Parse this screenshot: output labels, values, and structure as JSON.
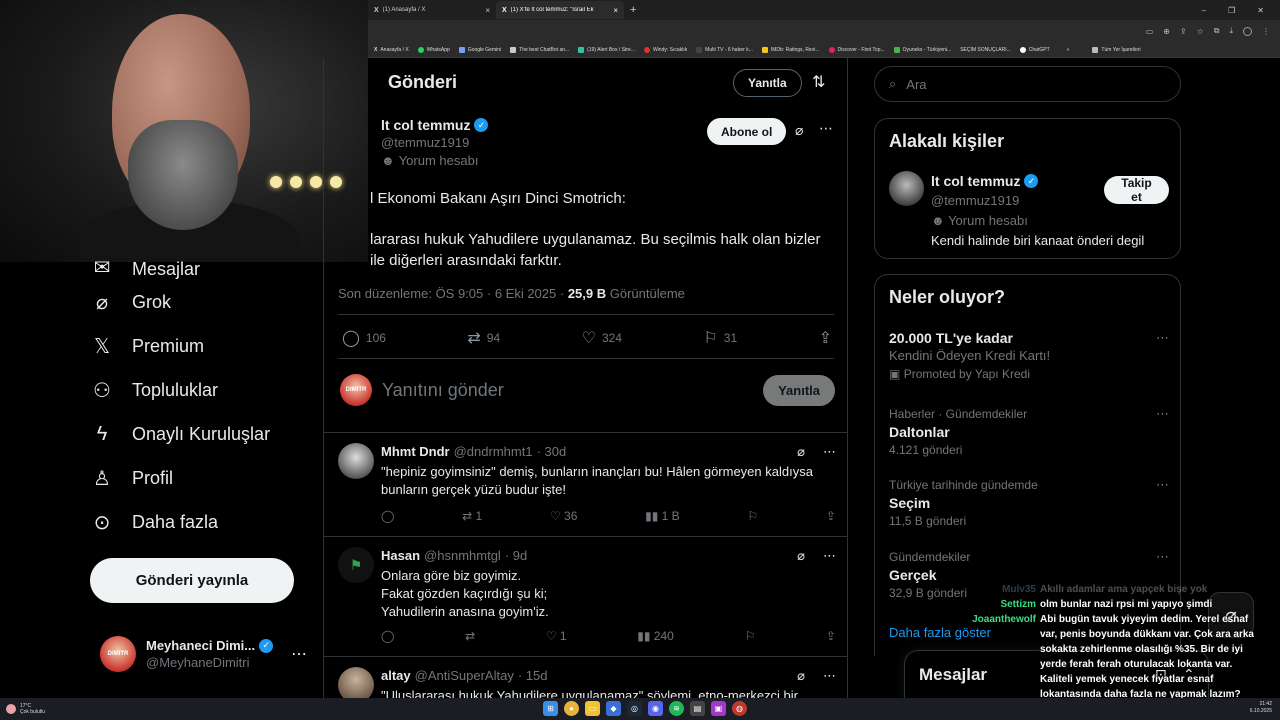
{
  "browser": {
    "tabs": [
      {
        "label": "(1) Anasayfa / X",
        "active": false
      },
      {
        "label": "(1) X'te lt col temmuz: \"İsrail Ek",
        "active": true
      }
    ],
    "bookmarks": [
      "Anasayfa / X",
      "WhatsApp",
      "Google Gemini",
      "The best ChatBot an...",
      "(19) Alert Box / Stre...",
      "Windy: Sıcaklık",
      "Multi TV - 6 haber k...",
      "IMDb: Ratings, Revi...",
      "Discover - Find Top...",
      "Oyuneks - Türkiyeni...",
      "SEÇİM SONUÇLARI...",
      "ChatGPT"
    ],
    "bookmarks_more": "»",
    "bookmarks_all": "Tüm Yer İşaretleri"
  },
  "leftnav": {
    "items": [
      {
        "icon": "mail-icon",
        "glyph": "✉",
        "label": "Mesajlar"
      },
      {
        "icon": "grok-icon",
        "glyph": "⌀",
        "label": "Grok"
      },
      {
        "icon": "x-logo-icon",
        "glyph": "𝕏",
        "label": "Premium"
      },
      {
        "icon": "communities-icon",
        "glyph": "👥",
        "label": "Topluluklar"
      },
      {
        "icon": "lightning-icon",
        "glyph": "ϟ",
        "label": "Onaylı Kuruluşlar"
      },
      {
        "icon": "person-icon",
        "glyph": "♙",
        "label": "Profil"
      },
      {
        "icon": "more-circle-icon",
        "glyph": "⋯",
        "label": "Daha fazla"
      }
    ],
    "post_button": "Gönderi yayınla",
    "profile": {
      "name": "Meyhaneci Dimi...",
      "handle": "@MeyhaneDimitri",
      "avatar_text": "DIMITR"
    }
  },
  "main": {
    "header": "Gönderi",
    "reply_button": "Yanıtla",
    "author": {
      "name": "lt col temmuz",
      "handle": "@temmuz1919",
      "label": "Yorum hesabı"
    },
    "follow_button": "Abone ol",
    "text_line1": "l Ekonomi Bakanı Aşırı Dinci Smotrich:",
    "text_line2": "lararası hukuk Yahudilere uygulanamaz. Bu seçilmis halk olan bizler ile diğerleri arasındaki farktır.",
    "meta": {
      "edited": "Son düzenleme: ÖS 9:05 · 6 Eki 2025 · ",
      "views": "25,9 B",
      "views_label": " Görüntüleme"
    },
    "stats": {
      "replies": "106",
      "reposts": "94",
      "likes": "324",
      "bookmarks": "31"
    },
    "compose": {
      "placeholder": "Yanıtını gönder",
      "button": "Yanıtla"
    },
    "replies": [
      {
        "name": "Mhmt Dndr",
        "handle": "@dndrmhmt1",
        "time": "· 30d",
        "text": "\"hepiniz goyimsiniz\" demiş, bunların inançları bu! Hâlen görmeyen kaldıysa bunların gerçek yüzü budur işte!",
        "replies": "",
        "reposts": "1",
        "likes": "36",
        "views": "1 B"
      },
      {
        "name": "Hasan",
        "handle": "@hsnmhmtgl",
        "time": "· 9d",
        "text1": "Onlara göre biz goyimiz.",
        "text2": "Fakat gözden kaçırdığı şu ki;",
        "text3": "Yahudilerin anasına goyim'iz.",
        "replies": "",
        "reposts": "",
        "likes": "1",
        "views": "240"
      },
      {
        "name": "altay",
        "handle": "@AntiSuperAltay",
        "time": "· 15d",
        "text": "\"Uluslararası hukuk Yahudilere uygulanamaz\" söylemi, etno-merkezci bir"
      }
    ]
  },
  "right": {
    "search_placeholder": "Ara",
    "related_title": "Alakalı kişiler",
    "related_user": {
      "name": "lt col temmuz",
      "handle": "@temmuz1919",
      "label": "Yorum hesabı",
      "bio": "Kendi halinde biri kanaat önderi degil",
      "button": "Takip et"
    },
    "trends_title": "Neler oluyor?",
    "trends": [
      {
        "cat": "",
        "title": "20.000 TL'ye kadar",
        "sub": "Kendini Ödeyen Kredi Kartı!",
        "count": "Promoted by Yapı Kredi"
      },
      {
        "cat": "Haberler · Gündemdekiler",
        "title": "Daltonlar",
        "sub": "",
        "count": "4.121 gönderi"
      },
      {
        "cat": "Türkiye tarihinde gündemde",
        "title": "Seçim",
        "sub": "",
        "count": "11,5 B gönderi"
      },
      {
        "cat": "Gündemdekiler",
        "title": "Gerçek",
        "sub": "",
        "count": "32,9 B gönderi"
      }
    ],
    "show_more": "Daha fazla göster",
    "messages_title": "Mesajlar"
  },
  "chat": [
    {
      "user": "Mulv35",
      "color": "#7fd4ff",
      "msg": "Akıllı adamlar ama yapçek bişe yok",
      "faded": true
    },
    {
      "user": "Settizm",
      "color": "#3ddc84",
      "msg": "olm bunlar nazi rpsi mi yapıyo şimdi",
      "faded": false
    },
    {
      "user": "",
      "color": "#ffffff",
      "msg": "Abi bugün tavuk yiyeyim dedim. Yerel esnaf var, penis boyunda dükkanı var. Çok ara arka sokakta zehirlenme olasılığı %35. Bir de iyi yerde ferah ferah oturulacak lokanta var. Kaliteli yemek yenecek fiyatlar esnaf lokantasında daha fazla ne yapmak lazım?",
      "faded": false
    },
    {
      "user": "Joaanthewolf",
      "color": "#3ddc84",
      "msg": "",
      "faded": false
    }
  ],
  "taskbar": {
    "temp": "17°C",
    "weather": "Çok bulutlu",
    "time": "21:42",
    "date": "6.10.2025"
  }
}
